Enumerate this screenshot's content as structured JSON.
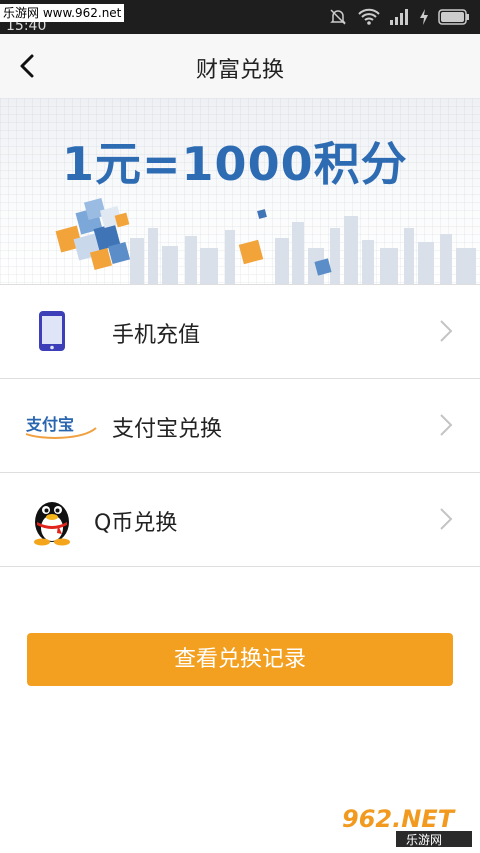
{
  "watermark_top": "乐游网 www.962.net",
  "status_bar": {
    "time": "15:40"
  },
  "header": {
    "title": "财富兑换"
  },
  "banner": {
    "text": "1元=1000积分"
  },
  "menu": [
    {
      "label": "手机充值",
      "icon": "phone-icon"
    },
    {
      "label": "支付宝兑换",
      "icon": "alipay-icon",
      "logo_text": "支付宝"
    },
    {
      "label": "Q币兑换",
      "icon": "qq-penguin-icon"
    }
  ],
  "record_button": {
    "label": "查看兑换记录",
    "color": "#f3a021"
  },
  "watermark_bottom": {
    "brand": "962.NET",
    "subtitle": "乐游网"
  }
}
